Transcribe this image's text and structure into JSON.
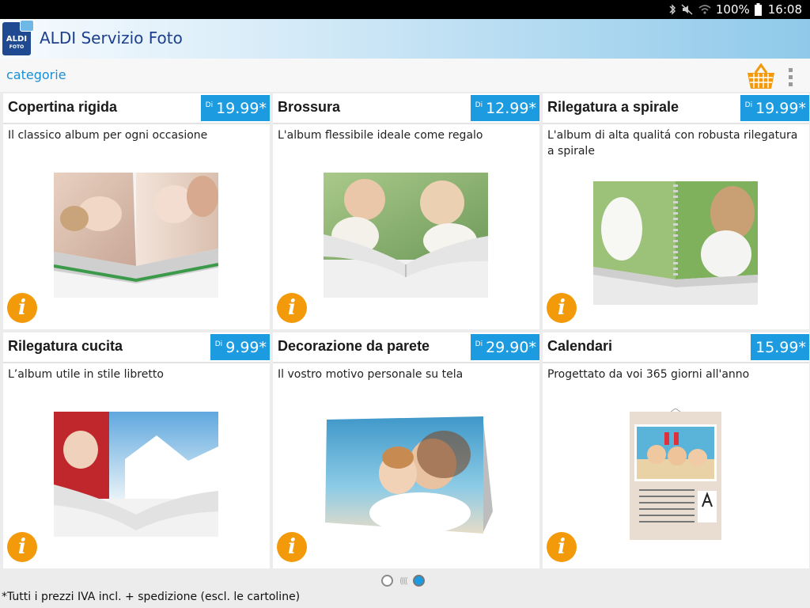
{
  "status_bar": {
    "battery": "100%",
    "time": "16:08"
  },
  "app": {
    "title": "ALDI Servizio Foto",
    "logo_line1": "ALDI",
    "logo_line2": "FOTO"
  },
  "subbar": {
    "categories_label": "categorie"
  },
  "products": [
    {
      "title": "Copertina rigida",
      "price_prefix": "Di",
      "price": "19.99*",
      "description": "Il classico album per ogni occasione"
    },
    {
      "title": "Brossura",
      "price_prefix": "Di",
      "price": "12.99*",
      "description": "L'album flessibile ideale come regalo"
    },
    {
      "title": "Rilegatura a spirale",
      "price_prefix": "Di",
      "price": "19.99*",
      "description": "L'album di alta qualitá con robusta rilegatura a spirale"
    },
    {
      "title": "Rilegatura cucita",
      "price_prefix": "Di",
      "price": "9.99*",
      "description": "L’album utile in stile libretto"
    },
    {
      "title": "Decorazione da parete",
      "price_prefix": "Di",
      "price": "29.90*",
      "description": "Il vostro motivo personale su tela"
    },
    {
      "title": "Calendari",
      "price_prefix": "",
      "price": "15.99*",
      "description": "Progettato da voi 365 giorni all'anno"
    }
  ],
  "info_glyph": "i",
  "footer": {
    "note": "*Tutti i prezzi IVA incl. + spedizione (escl. le cartoline)"
  },
  "colors": {
    "accent": "#1c9be0",
    "info": "#f39a0b",
    "brand": "#1d3f8c"
  }
}
